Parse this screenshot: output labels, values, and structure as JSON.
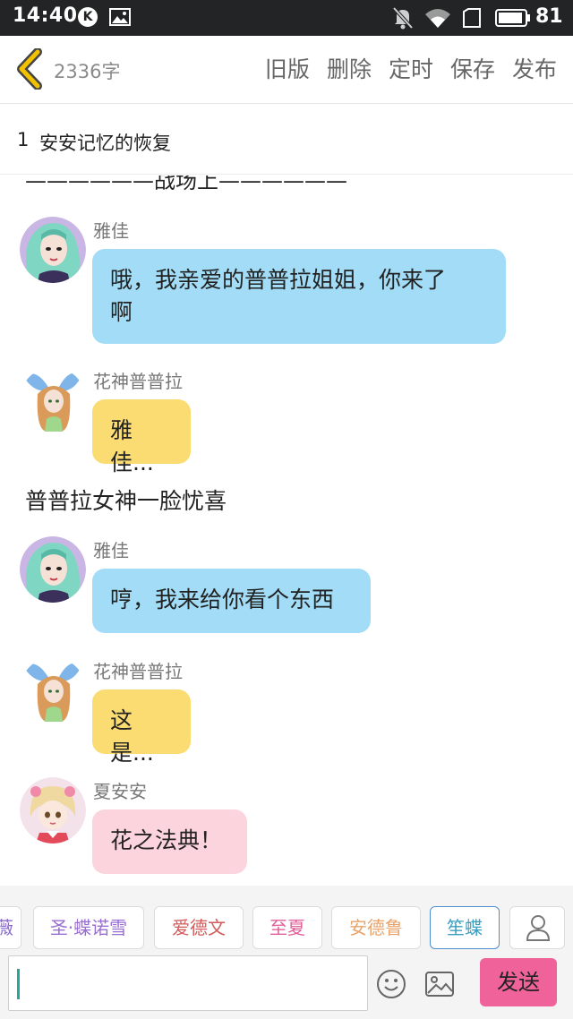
{
  "status_bar": {
    "time": "14:40",
    "k_badge": "K",
    "battery": "81"
  },
  "toolbar": {
    "word_count": "2336字",
    "actions": [
      "旧版",
      "删除",
      "定时",
      "保存",
      "发布"
    ]
  },
  "chapter": {
    "number": "1",
    "title": "安安记忆的恢复"
  },
  "content": {
    "scene_divider": "——————战场上——————",
    "messages": [
      {
        "speaker": "雅佳",
        "text_line1": "哦，我亲爱的普普拉姐姐，你来了",
        "text_line2": "啊",
        "color": "blue"
      },
      {
        "speaker": "花神普普拉",
        "text": "雅佳...",
        "color": "yellow"
      },
      {
        "speaker": "雅佳",
        "text": "哼，我来给你看个东西",
        "color": "blue"
      },
      {
        "speaker": "花神普普拉",
        "text": "这是...",
        "color": "yellow"
      },
      {
        "speaker": "夏安安",
        "text": "花之法典！",
        "color": "pink"
      }
    ],
    "narration": "普普拉女神一脸忧喜"
  },
  "character_bar": {
    "chips": [
      {
        "label": "薇",
        "color": "#8b6bd1"
      },
      {
        "label": "圣·蝶诺雪",
        "color": "#9a6fd3"
      },
      {
        "label": "爱德文",
        "color": "#d25a5a"
      },
      {
        "label": "至夏",
        "color": "#e0609a"
      },
      {
        "label": "安德鲁",
        "color": "#e8a36b"
      },
      {
        "label": "笙蝶",
        "color": "#3a9fbf",
        "selected": true
      }
    ],
    "user_icon": "user-icon"
  },
  "input": {
    "value": "",
    "placeholder": "",
    "send_label": "发送"
  },
  "colors": {
    "blue_bubble": "#a2dcf6",
    "yellow_bubble": "#fbdc72",
    "pink_bubble": "#fbd4dd",
    "send_button": "#f0629a",
    "back_arrow": "#f2c200"
  }
}
